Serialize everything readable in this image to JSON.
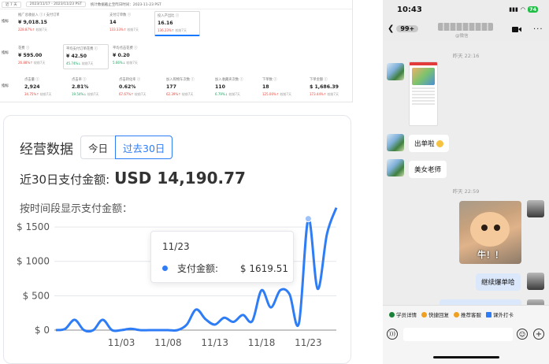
{
  "ads": {
    "toolbar": {
      "range": "近 7 天",
      "dates": "2023/11/17 - 2023/11/23 PST",
      "note": "统计数据截止至昨日时间：2023-11-23 PST"
    },
    "sections": [
      {
        "label": "指标",
        "metrics": [
          {
            "label": "推广总收益入 ⓘ / 支付订单额 · 花费",
            "value": "¥ 9,018.15",
            "delta_up": "228.87%↑",
            "delta_note": "较前7天",
            "color": "red"
          },
          {
            "label": "支付订单数 ⓘ",
            "value": "14",
            "delta_up": "133.33%↑",
            "delta_note": "较前7天",
            "color": "red"
          },
          {
            "label": "投入产出比 ⓘ",
            "value": "16.16",
            "delta_up": "136.23%↑",
            "delta_note": "较前7天",
            "color": "red"
          }
        ]
      },
      {
        "label": "指标",
        "metrics": [
          {
            "label": "花费 ⓘ",
            "value": "¥ 595.00",
            "delta_up": "26.88%↑",
            "delta_note": "较前7天",
            "color": "red"
          },
          {
            "label": "平均支付订单花费 ⓘ",
            "value": "¥ 42.50",
            "delta_up": "45.74%↓",
            "delta_note": "较前7天",
            "color": "green"
          },
          {
            "label": "平均点击花费 ⓘ",
            "value": "¥ 0.20",
            "delta_up": "5.66%↓",
            "delta_note": "较前7天",
            "color": "green"
          }
        ]
      },
      {
        "label": "指标",
        "metrics": [
          {
            "label": "点击量 ⓘ",
            "value": "2,924",
            "delta_up": "34.75%↑",
            "delta_note": "较前7天",
            "color": "red"
          },
          {
            "label": "点击率 ⓘ",
            "value": "2.81%",
            "delta_up": "19.54%↓",
            "delta_note": "较前7天",
            "color": "green"
          },
          {
            "label": "点击转化率 ⓘ",
            "value": "0.62%",
            "delta_up": "67.67%↑",
            "delta_note": "较前7天",
            "color": "red"
          },
          {
            "label": "加入购物车次数 ⓘ",
            "value": "177",
            "delta_up": "62.39%↑",
            "delta_note": "较前7天",
            "color": "red"
          },
          {
            "label": "加入收藏夹次数 ⓘ",
            "value": "110",
            "delta_up": "6.79%↓",
            "delta_note": "较前7天",
            "color": "green"
          },
          {
            "label": "下单数 ⓘ",
            "value": "18",
            "delta_up": "125.00%↑",
            "delta_note": "较前7天",
            "color": "red"
          },
          {
            "label": "下单金额 ⓘ",
            "value": "$ 1,686.39",
            "delta_up": "173.44%↑",
            "delta_note": "较前7天",
            "color": "red"
          }
        ]
      }
    ]
  },
  "ops": {
    "title": "经营数据",
    "tab_today": "今日",
    "tab_30d": "过去30日",
    "total_label": "近30日支付金额:",
    "total_value": "USD 14,190.77",
    "subtitle": "按时间段显示支付金额：",
    "tooltip_date": "11/23",
    "tooltip_key": "支付金额:",
    "tooltip_value": "$ 1619.51"
  },
  "chart_data": {
    "type": "line",
    "title": "",
    "xlabel": "",
    "ylabel": "",
    "ylim": [
      0,
      1650
    ],
    "yticks": [
      "$ 0",
      "$ 500",
      "$ 1000",
      "$ 1500"
    ],
    "ytick_values": [
      0,
      500,
      1000,
      1500
    ],
    "xticks": [
      "11/03",
      "11/08",
      "11/13",
      "11/18",
      "11/23"
    ],
    "x": [
      "10/27",
      "10/28",
      "10/29",
      "10/30",
      "10/31",
      "11/01",
      "11/02",
      "11/03",
      "11/04",
      "11/05",
      "11/06",
      "11/07",
      "11/08",
      "11/09",
      "11/10",
      "11/11",
      "11/12",
      "11/13",
      "11/14",
      "11/15",
      "11/16",
      "11/17",
      "11/18",
      "11/19",
      "11/20",
      "11/21",
      "11/22",
      "11/23",
      "11/24",
      "11/25",
      "11/26"
    ],
    "series": [
      {
        "color": "#2f7df6",
        "values": [
          0,
          20,
          150,
          0,
          0,
          150,
          0,
          0,
          20,
          0,
          0,
          0,
          0,
          0,
          80,
          300,
          160,
          80,
          180,
          120,
          220,
          130,
          580,
          330,
          580,
          520,
          100,
          1619.51,
          600,
          1400,
          1780
        ]
      }
    ],
    "highlight_index": 27,
    "grid": true,
    "legend": "none"
  },
  "phone": {
    "time": "10:43",
    "battery": "74",
    "back_badge": "99+",
    "sub_title": "@微信",
    "stamp1": "昨天 22:16",
    "stamp2": "昨天 22:59",
    "msg1": "出单啦",
    "msg2": "美女老师",
    "sticker_caption": "牛！！",
    "msg3": "继续爆单哈",
    "quick": [
      "学员详情",
      "快捷回复",
      "推荐客服",
      "课外打卡"
    ]
  }
}
